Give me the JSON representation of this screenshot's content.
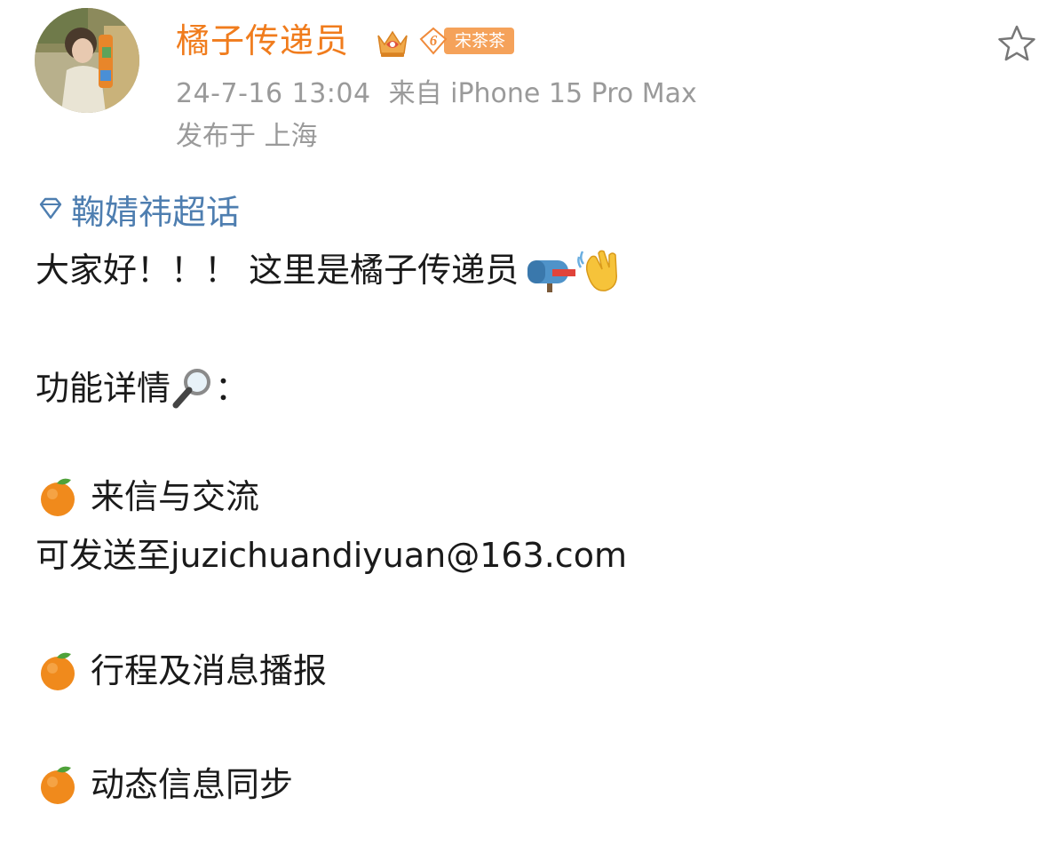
{
  "post": {
    "user": {
      "name": "橘子传递员",
      "avatar_alt": "avatar",
      "crown_icon": "crown-icon",
      "fan_badge": {
        "level": "6",
        "name": "宋茶茶"
      }
    },
    "meta": {
      "time": "24-7-16 13:04",
      "source": "来自 iPhone 15 Pro Max",
      "location": "发布于 上海"
    },
    "favorite_icon": "star-icon",
    "topic": {
      "icon": "super-topic-diamond-icon",
      "label": "鞠婧祎超话"
    },
    "content": {
      "greeting": "大家好！！！ 这里是橘子传递员",
      "features_heading": "功能详情",
      "features_colon": "：",
      "item1_title": "来信与交流",
      "item1_detail": "可发送至juzichuandiyuan@163.com",
      "item2_title": "行程及消息播报",
      "item3_title": "动态信息同步"
    },
    "colors": {
      "username": "#f07c1d",
      "meta": "#9a9a9a",
      "topic": "#4e7eb0",
      "fan_badge_bg": "#f5a25a"
    }
  }
}
